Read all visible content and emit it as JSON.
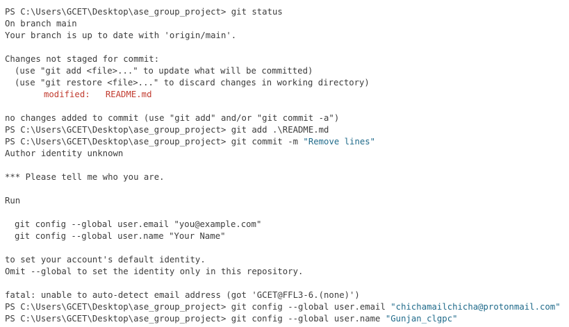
{
  "terminal": {
    "prompt": "PS C:\\Users\\GCET\\Desktop\\ase_group_project>",
    "colors": {
      "background": "#ffffff",
      "text": "#3b3b3b",
      "string": "#1f6a8a",
      "modified": "#c13b2f"
    },
    "cmd1": "git status",
    "out_branch": "On branch main",
    "out_uptodate": "Your branch is up to date with 'origin/main'.",
    "out_changes_header": "Changes not staged for commit:",
    "out_hint_add": "(use \"git add <file>...\" to update what will be committed)",
    "out_hint_restore": "(use \"git restore <file>...\" to discard changes in working directory)",
    "out_modified": "modified:   README.md",
    "out_no_changes": "no changes added to commit (use \"git add\" and/or \"git commit -a\")",
    "cmd2": "git add .\\README.md",
    "cmd3_cmd": "git commit -m",
    "cmd3_arg": "\"Remove lines\"",
    "out_author_unknown": "Author identity unknown",
    "out_tell_me": "*** Please tell me who you are.",
    "out_run": "Run",
    "out_cfg_email": "git config --global user.email \"you@example.com\"",
    "out_cfg_name": "git config --global user.name \"Your Name\"",
    "out_to_set": "to set your account's default identity.",
    "out_omit": "Omit --global to set the identity only in this repository.",
    "out_fatal": "fatal: unable to auto-detect email address (got 'GCET@FFL3-6.(none)')",
    "cmd4_cmd": "git config --global user.email",
    "cmd4_arg": "\"chichamailchicha@protonmail.com\"",
    "cmd5_cmd": "git config --global user.name",
    "cmd5_arg": "\"Gunjan_clgpc\""
  }
}
